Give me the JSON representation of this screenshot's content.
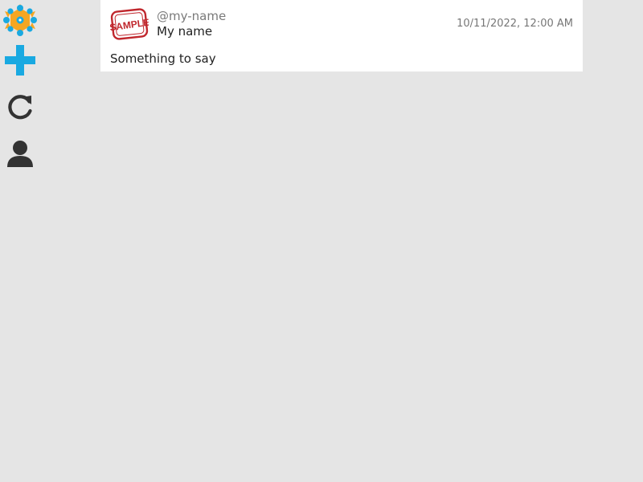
{
  "sidebar": {
    "items": [
      {
        "icon": "app-logo-icon",
        "accent": "#19a9e1",
        "secondary": "#f5a623"
      },
      {
        "icon": "add-icon",
        "accent": "#19a9e1"
      },
      {
        "icon": "refresh-icon",
        "accent": "#333333"
      },
      {
        "icon": "user-icon",
        "accent": "#333333"
      }
    ]
  },
  "post": {
    "avatar_stamp_text": "SAMPLE",
    "avatar_color": "#c0272d",
    "handle": "@my-name",
    "display_name": "My name",
    "timestamp": "10/11/2022, 12:00 AM",
    "text": "Something to say"
  },
  "colors": {
    "background": "#e5e5e5",
    "card": "#ffffff"
  }
}
